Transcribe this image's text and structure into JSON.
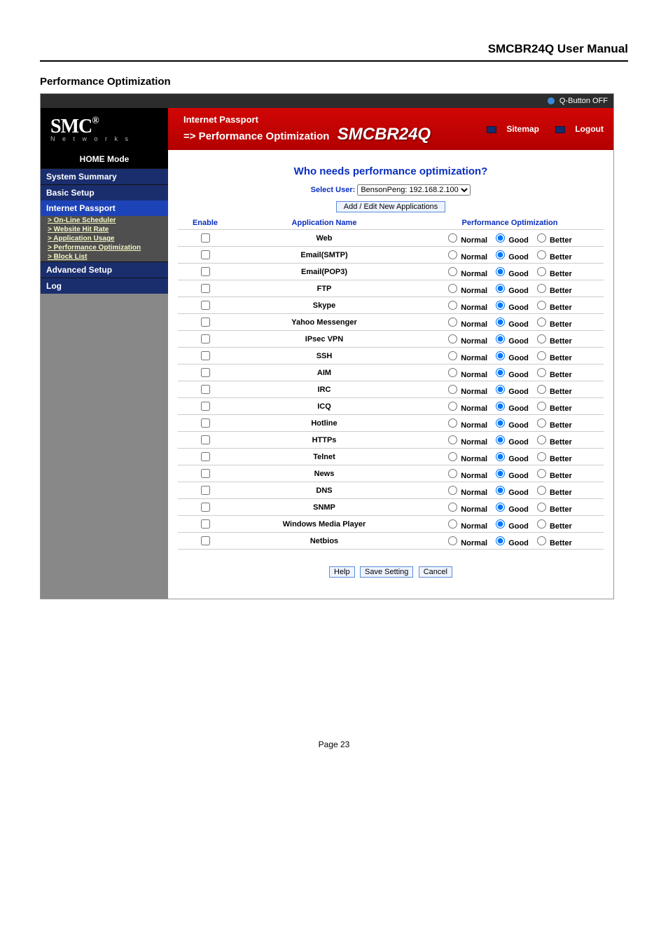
{
  "doc": {
    "manual_title": "SMCBR24Q User Manual",
    "section_heading": "Performance Optimization",
    "page_number": "Page 23"
  },
  "qbar": {
    "label": "Q-Button OFF"
  },
  "banner": {
    "logo": "SMC",
    "logo_reg": "®",
    "logo_sub": "N  e  t  w  o  r  k  s",
    "bc_line1": "Internet Passport",
    "bc_line2": "=> Performance Optimization",
    "model": "SMCBR24Q",
    "sitemap": "Sitemap",
    "logout": "Logout"
  },
  "nav": {
    "home": "HOME Mode",
    "system_summary": "System Summary",
    "basic_setup": "Basic Setup",
    "internet_passport": "Internet Passport",
    "subs": [
      "> On-Line Scheduler",
      "> Website Hit Rate",
      "> Application Usage",
      "> Performance Optimization",
      "> Block List"
    ],
    "advanced_setup": "Advanced Setup",
    "log": "Log"
  },
  "content": {
    "heading": "Who needs performance optimization?",
    "select_user_label": "Select User:",
    "select_user_value": "BensonPeng: 192.168.2.100",
    "add_edit": "Add / Edit New Applications",
    "th_enable": "Enable",
    "th_app": "Application Name",
    "th_perf": "Performance Optimization",
    "opt_normal": "Normal",
    "opt_good": "Good",
    "opt_better": "Better",
    "apps": [
      "Web",
      "Email(SMTP)",
      "Email(POP3)",
      "FTP",
      "Skype",
      "Yahoo Messenger",
      "IPsec VPN",
      "SSH",
      "AIM",
      "IRC",
      "ICQ",
      "Hotline",
      "HTTPs",
      "Telnet",
      "News",
      "DNS",
      "SNMP",
      "Windows Media Player",
      "Netbios"
    ],
    "btn_help": "Help",
    "btn_save": "Save Setting",
    "btn_cancel": "Cancel"
  }
}
